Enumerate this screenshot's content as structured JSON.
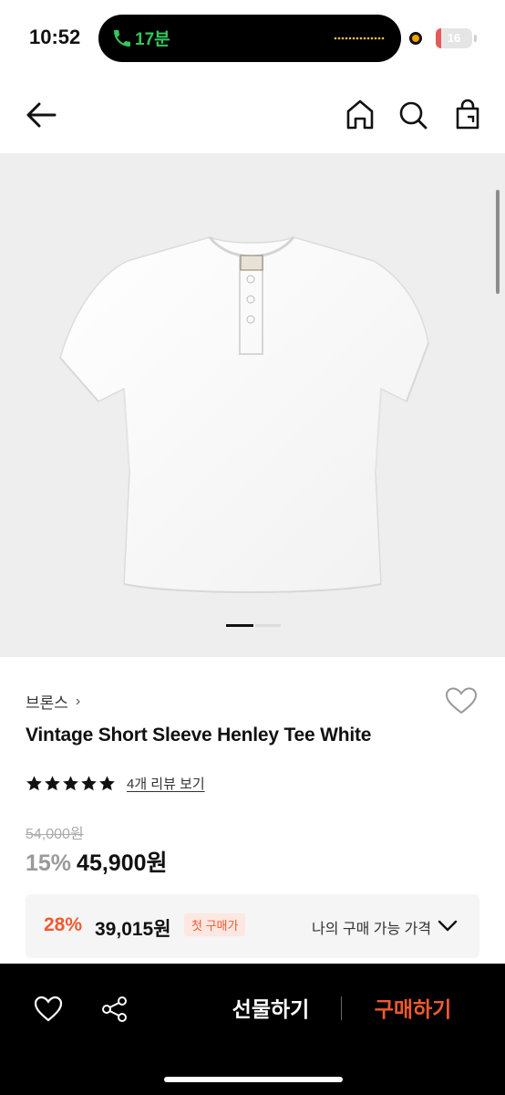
{
  "status_bar": {
    "time": "10:52",
    "call_duration": "17분",
    "battery": "16",
    "battery_level": 0.16,
    "colors": {
      "call_green": "#34c759",
      "battery_red": "#e35a5a",
      "indicator_orange": "#f3a000"
    }
  },
  "nav": {
    "icons": [
      "back-arrow-icon",
      "home-icon",
      "search-icon",
      "shopping-bag-icon"
    ]
  },
  "gallery": {
    "image_subject": "white henley t-shirt",
    "active_slide_indicator": true
  },
  "product": {
    "brand": "브론스",
    "brand_chevron": "›",
    "title": "Vintage Short Sleeve Henley Tee White",
    "rating": 5,
    "review_link": "4개 리뷰 보기",
    "original_price": "54,000원",
    "discount_rate": "15%",
    "price": "45,900원"
  },
  "coupon": {
    "discount_rate": "28%",
    "price": "39,015원",
    "badge": "첫 구매가",
    "label": "나의 구매 가능 가격",
    "accent_color": "#ef5a2f"
  },
  "bottom_bar": {
    "gift_label": "선물하기",
    "buy_label": "구매하기",
    "icons": [
      "heart-icon",
      "share-icon"
    ]
  }
}
